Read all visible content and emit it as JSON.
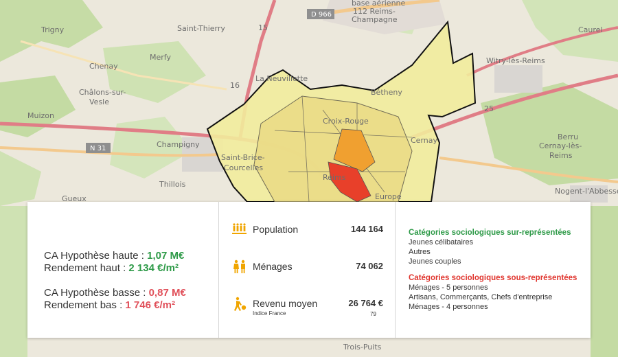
{
  "map": {
    "places": [
      "Trigny",
      "Saint-Thierry",
      "Chenay",
      "Merfy",
      "Châlons-sur-",
      "Vesle",
      "La Neuvillette",
      "Caurel",
      "Witry-lès-Reims",
      "Muizon",
      "Champigny",
      "Saint-Brice-",
      "Courcelles",
      "Thillois",
      "Gueux",
      "Cernay-lès-",
      "Reims",
      "Berru",
      "Nogent-l'Abbesse",
      "Trois-Puits",
      "Bétheny",
      "Cernay",
      "Europe",
      "Reims",
      "Croix-Rouge"
    ],
    "roads": [
      "D 966",
      "N 31",
      "15",
      "16",
      "25"
    ],
    "airbase": [
      "base aérienne",
      "112 Reims-",
      "Champagne"
    ],
    "colors": {
      "zone_light": "#f2ec9c",
      "zone_mid": "#f0d070",
      "zone_orange": "#f0a030",
      "zone_red": "#e8402a",
      "road_main": "#e07d86",
      "road_secondary": "#f3c98d"
    }
  },
  "summary": {
    "high": {
      "label": "CA Hypothèse haute : ",
      "value": "1,07 M€"
    },
    "yield_high": {
      "label": "Rendement haut : ",
      "value": "2 134 €/m²"
    },
    "low": {
      "label": "CA Hypothèse basse : ",
      "value": "0,87 M€"
    },
    "yield_low": {
      "label": "Rendement bas : ",
      "value": "1 746 €/m²"
    }
  },
  "stats": {
    "population": {
      "label": "Population",
      "value": "144 164",
      "icon": "population-icon"
    },
    "households": {
      "label": "Ménages",
      "value": "74 062",
      "icon": "households-icon"
    },
    "income": {
      "label": "Revenu moyen",
      "value": "26 764 €",
      "sub_label": "Indice France",
      "sub_value": "79",
      "icon": "income-icon"
    }
  },
  "categories": {
    "over_title": "Catégories sociologiques sur-représentées",
    "over": [
      "Jeunes célibataires",
      "Autres",
      "Jeunes couples"
    ],
    "under_title": "Catégories sociologiques sous-représentées",
    "under": [
      "Ménages - 5 personnes",
      "Artisans, Commerçants, Chefs d'entreprise",
      "Ménages - 4 personnes"
    ]
  }
}
